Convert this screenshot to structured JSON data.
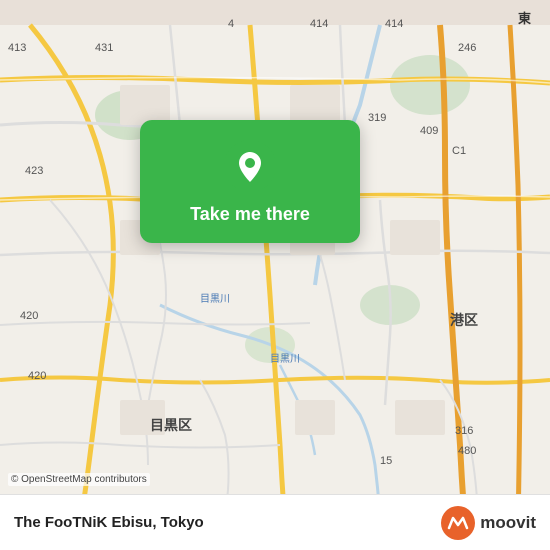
{
  "map": {
    "attribution": "© OpenStreetMap contributors",
    "center_label": "目黒区",
    "district_label": "港区",
    "district2_label": "目黒川",
    "river_label": "目黒川",
    "road_numbers": [
      "431",
      "4",
      "414",
      "414",
      "246",
      "413",
      "319",
      "C1",
      "409",
      "423",
      "420",
      "316",
      "420",
      "15",
      "480"
    ],
    "background_color": "#f2efe9"
  },
  "card": {
    "button_label": "Take me there",
    "pin_color": "#ffffff"
  },
  "bottom_bar": {
    "place_name": "The FooTNiK Ebisu, Tokyo",
    "logo_text": "moovit"
  },
  "colors": {
    "card_green": "#3ab54a",
    "road_yellow": "#f5c842",
    "road_orange": "#e8a030",
    "water_blue": "#b8d4e8",
    "green_area": "#c8ddc0",
    "accent_orange": "#e8622a"
  }
}
